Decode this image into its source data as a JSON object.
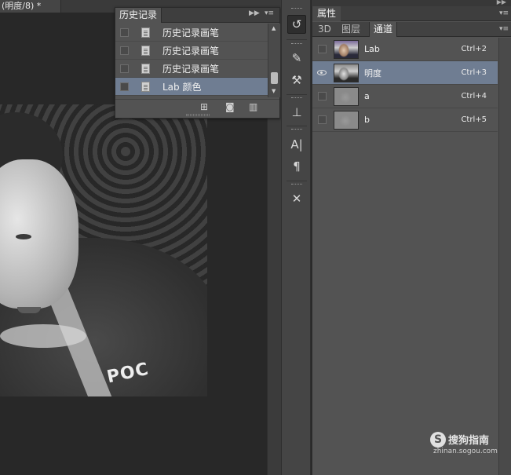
{
  "document": {
    "tab_title": "(明度/8) *"
  },
  "history_panel": {
    "title": "历史记录",
    "items": [
      {
        "label": "历史记录画笔",
        "selected": false
      },
      {
        "label": "历史记录画笔",
        "selected": false
      },
      {
        "label": "历史记录画笔",
        "selected": false
      },
      {
        "label": "Lab 颜色",
        "selected": true
      }
    ],
    "footer_icons": [
      "new-document-icon",
      "camera-icon",
      "trash-icon"
    ]
  },
  "tool_strip": {
    "buttons": [
      "history-brush-icon",
      "brush-presets-icon",
      "brush-settings-icon",
      "clone-source-icon",
      "character-icon",
      "paragraph-icon",
      "tools-icon"
    ]
  },
  "right_panel": {
    "top_tab": "属性",
    "tabs": [
      {
        "label": "3D",
        "active": false
      },
      {
        "label": "图层",
        "active": false
      },
      {
        "label": "通道",
        "active": true
      }
    ],
    "channels": [
      {
        "name": "Lab",
        "shortcut": "Ctrl+2",
        "visible": false,
        "selected": false,
        "thumb": "color"
      },
      {
        "name": "明度",
        "shortcut": "Ctrl+3",
        "visible": true,
        "selected": true,
        "thumb": "gray"
      },
      {
        "name": "a",
        "shortcut": "Ctrl+4",
        "visible": false,
        "selected": false,
        "thumb": "flat"
      },
      {
        "name": "b",
        "shortcut": "Ctrl+5",
        "visible": false,
        "selected": false,
        "thumb": "flat"
      }
    ]
  },
  "photo": {
    "shirt_text": "POC"
  },
  "watermark": {
    "logo_letter": "S",
    "brand": "搜狗指南",
    "url": "zhinan.sogou.com"
  }
}
